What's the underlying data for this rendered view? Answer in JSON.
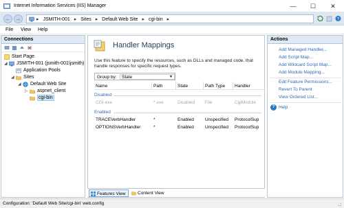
{
  "window": {
    "title": "Internet Information Services (IIS) Manager"
  },
  "breadcrumb": [
    "JSMITH-001",
    "Sites",
    "Default Web Site",
    "cgi-bin"
  ],
  "menu": [
    "File",
    "View",
    "Help"
  ],
  "connections": {
    "title": "Connections",
    "tree": [
      {
        "label": "Start Page"
      },
      {
        "label": "JSMITH-001 (jsmith-001\\jsmith)"
      },
      {
        "label": "Application Pools"
      },
      {
        "label": "Sites"
      },
      {
        "label": "Default Web Site"
      },
      {
        "label": "aspnet_client"
      },
      {
        "label": "cgi-bin"
      }
    ]
  },
  "center": {
    "title": "Handler Mappings",
    "description": "Use this feature to specify the resources, such as DLLs and managed code, that handle responses for specific request types.",
    "group_by_label": "Group by:",
    "group_by_value": "State",
    "columns": [
      "Name",
      "Path",
      "State",
      "Path Type",
      "Handler"
    ],
    "groups": [
      {
        "title": "Disabled",
        "rows": [
          [
            "CGI-exe",
            "*.exe",
            "Disabled",
            "File",
            "CgiModule"
          ]
        ]
      },
      {
        "title": "Enabled",
        "rows": [
          [
            "TRACEVerbHandler",
            "*",
            "Enabled",
            "Unspecified",
            "ProtocolSup"
          ],
          [
            "OPTIONSVerbHandler",
            "*",
            "Enabled",
            "Unspecified",
            "ProtocolSup"
          ]
        ]
      }
    ],
    "tabs": [
      "Features View",
      "Content View"
    ]
  },
  "actions": {
    "title": "Actions",
    "items": [
      "Add Managed Handler...",
      "Add Script Map...",
      "Add Wildcard Script Map...",
      "Add Module Mapping...",
      "Edit Feature Permissions...",
      "Revert To Parent",
      "View Ordered List...",
      "Help"
    ]
  },
  "status": {
    "text": "Configuration: 'Default Web Site/cgi-bin' web.config"
  },
  "colors": {
    "accent": "#2c6ab1",
    "header_bg": "#dfe9f5",
    "selection": "#cce4f7"
  }
}
